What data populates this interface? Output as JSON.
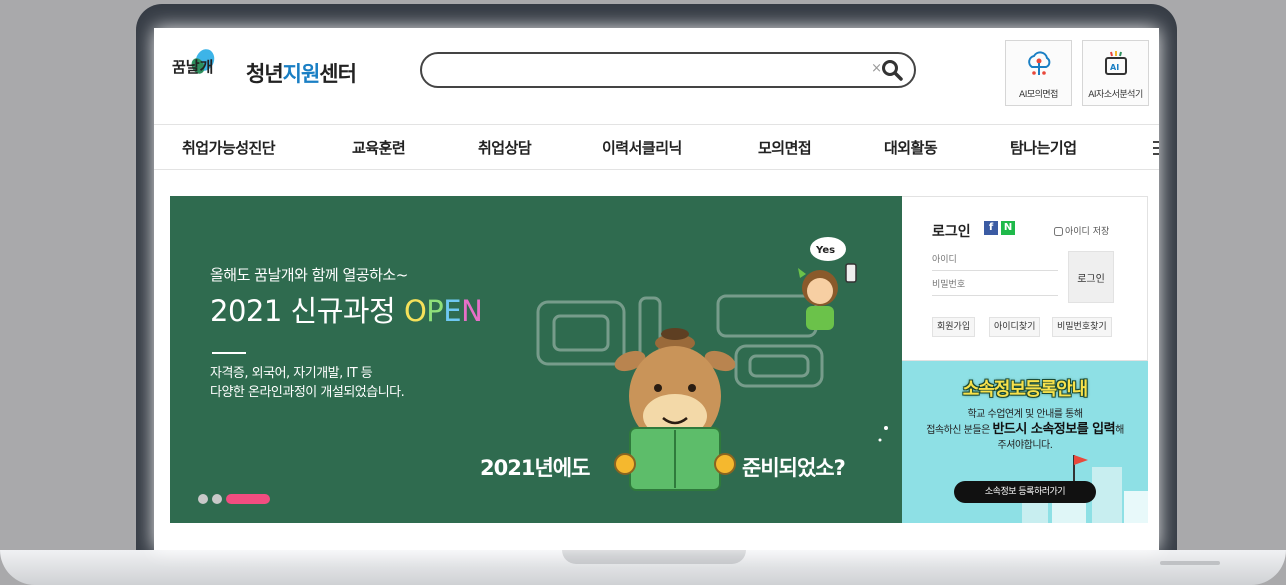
{
  "logo": {
    "mark_text": "꿈날개",
    "name_pre": "청년",
    "name_accent": "지원",
    "name_post": "센터"
  },
  "search": {
    "value": "",
    "clear_glyph": "×"
  },
  "quick_links": [
    {
      "label": "AI모의면접",
      "icon": "ai-interview-icon"
    },
    {
      "label": "AI자소서분석기",
      "icon": "ai-resume-analyzer-icon"
    }
  ],
  "nav": {
    "items": [
      "취업가능성진단",
      "교육훈련",
      "취업상담",
      "이력서클리닉",
      "모의면접",
      "대외활동",
      "탐나는기업"
    ]
  },
  "banner": {
    "subtitle": "올해도 꿈날개와 함께 열공하소~",
    "title_main": "2021 신규과정 ",
    "title_o1": "O",
    "title_o2": "P",
    "title_o3": "E",
    "title_o4": "N",
    "desc_line1": "자격증, 외국어, 자기개발, IT 등",
    "desc_line2": "다양한 온라인과정이 개설되었습니다.",
    "caption_left": "2021년에도",
    "caption_right": "준비되었소?",
    "bubble": "Yes",
    "slide_active": 3,
    "slide_count": 3
  },
  "login": {
    "title": "로그인",
    "facebook": "f",
    "naver": "N",
    "save_id": "아이디 저장",
    "id_placeholder": "아이디",
    "pw_placeholder": "비밀번호",
    "button": "로그인",
    "links": [
      "회원가입",
      "아이디찾기",
      "비밀번호찾기"
    ]
  },
  "promo": {
    "title": "소속정보등록안내",
    "line1": "학교 수업연계 및 안내를 통해",
    "line2_pre": "접속하신 분들은 ",
    "line2_bold": "반드시 소속정보를 입력",
    "line2_post": "해",
    "line3": "주셔야합니다.",
    "button": "소속정보 등록하러가기"
  },
  "colors": {
    "banner_bg": "#2f6b4f",
    "promo_bg": "#8ee0e5",
    "brand": "#1a7fc4",
    "slide_active": "#f24d80",
    "laptop_frame": "#363c45"
  }
}
